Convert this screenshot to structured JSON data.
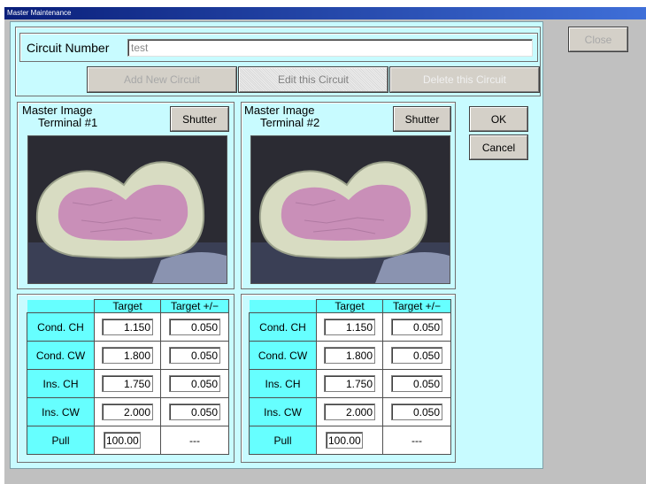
{
  "window": {
    "title": "Master Maintenance",
    "close_label": "Close"
  },
  "circuit": {
    "label": "Circuit Number",
    "value": "test",
    "add_label": "Add New Circuit",
    "edit_label": "Edit this Circuit",
    "delete_label": "Delete this Circuit"
  },
  "terminals": [
    {
      "title_line1": "Master Image",
      "title_line2": "Terminal #1",
      "shutter_label": "Shutter",
      "table": {
        "headers": [
          "Target",
          "Target +/−"
        ],
        "rows": [
          {
            "label": "Cond. CH",
            "target": "1.150",
            "tol": "0.050"
          },
          {
            "label": "Cond. CW",
            "target": "1.800",
            "tol": "0.050"
          },
          {
            "label": "Ins. CH",
            "target": "1.750",
            "tol": "0.050"
          },
          {
            "label": "Ins. CW",
            "target": "2.000",
            "tol": "0.050"
          },
          {
            "label": "Pull",
            "target": "100.00",
            "tol": "---"
          }
        ]
      }
    },
    {
      "title_line1": "Master Image",
      "title_line2": "Terminal #2",
      "shutter_label": "Shutter",
      "table": {
        "headers": [
          "Target",
          "Target +/−"
        ],
        "rows": [
          {
            "label": "Cond. CH",
            "target": "1.150",
            "tol": "0.050"
          },
          {
            "label": "Cond. CW",
            "target": "1.800",
            "tol": "0.050"
          },
          {
            "label": "Ins. CH",
            "target": "1.750",
            "tol": "0.050"
          },
          {
            "label": "Ins. CW",
            "target": "2.000",
            "tol": "0.050"
          },
          {
            "label": "Pull",
            "target": "100.00",
            "tol": "---"
          }
        ]
      }
    }
  ],
  "actions": {
    "ok_label": "OK",
    "cancel_label": "Cancel"
  }
}
